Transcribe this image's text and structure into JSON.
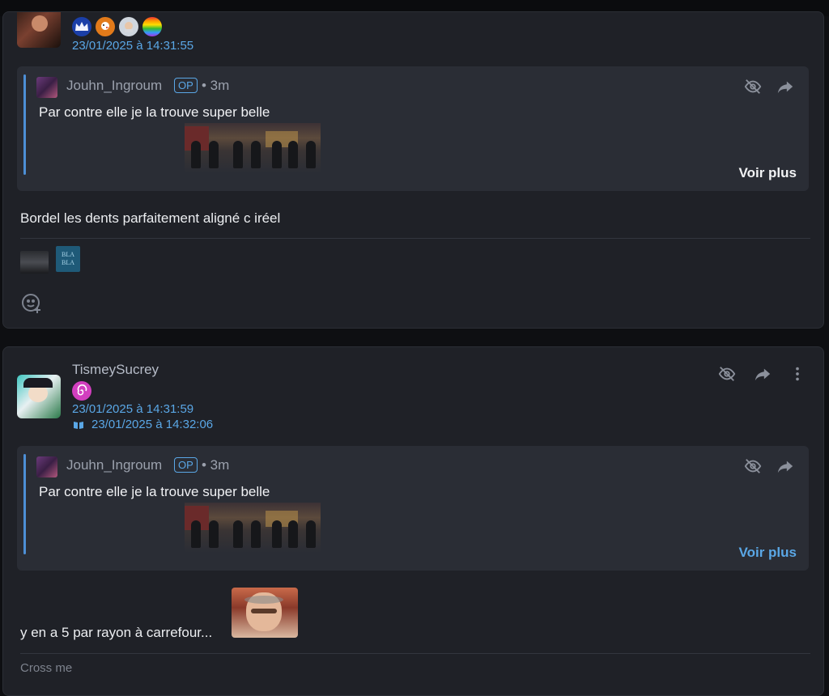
{
  "post1": {
    "date": "23/01/2025 à 14:31:55",
    "badges": [
      "crown-badge",
      "duck-badge",
      "face-badge",
      "rainbow-badge"
    ],
    "quote": {
      "username": "Jouhn_Ingroum",
      "op_label": "OP",
      "time": "• 3m",
      "text": "Par contre elle je la trouve super belle",
      "more_label": "Voir plus"
    },
    "text": "Bordel les dents parfaitement aligné c iréel",
    "sticker_bla_text": "BLA BLA"
  },
  "post2": {
    "username": "TismeySucrey",
    "badges": [
      "swirl-badge"
    ],
    "date": "23/01/2025 à 14:31:59",
    "edited_date": "23/01/2025 à 14:32:06",
    "quote": {
      "username": "Jouhn_Ingroum",
      "op_label": "OP",
      "time": "• 3m",
      "text": "Par contre elle je la trouve super belle",
      "more_label": "Voir plus"
    },
    "text": "y en a 5 par rayon à carrefour...",
    "signature": "Cross me"
  },
  "colors": {
    "accent": "#5aa7e6",
    "card_bg": "#1f2127",
    "quote_bg": "#2a2d35",
    "page_bg": "#0e0f12"
  }
}
